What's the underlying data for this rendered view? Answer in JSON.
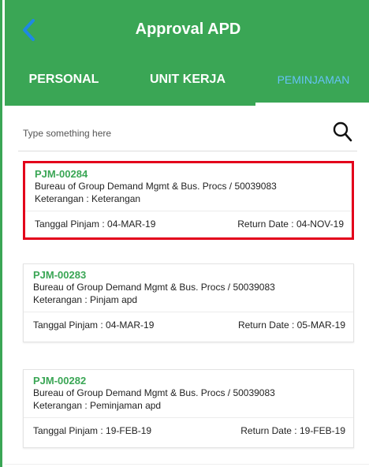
{
  "header": {
    "title": "Approval APD",
    "back_icon": "chevron-left-icon"
  },
  "tabs": [
    {
      "label": "PERSONAL",
      "active": false
    },
    {
      "label": "UNIT KERJA",
      "active": false
    },
    {
      "label": "PEMINJAMAN",
      "active": true
    }
  ],
  "search": {
    "placeholder": "Type something here",
    "value": "",
    "icon": "search-icon"
  },
  "colors": {
    "primary": "#3aa655",
    "active_tab_text": "#66c2f7",
    "highlight_border": "#e3001b",
    "code_text": "#3aa655"
  },
  "items": [
    {
      "code": "PJM-00284",
      "unit": "Bureau of Group Demand Mgmt & Bus. Procs / 50039083",
      "keterangan": "Keterangan : Keterangan",
      "tanggal_pinjam": "Tanggal Pinjam : 04-MAR-19",
      "return_date": "Return Date : 04-NOV-19",
      "selected": true
    },
    {
      "code": "PJM-00283",
      "unit": "Bureau of Group Demand Mgmt & Bus. Procs / 50039083",
      "keterangan": "Keterangan : Pinjam apd",
      "tanggal_pinjam": "Tanggal Pinjam : 04-MAR-19",
      "return_date": "Return Date : 05-MAR-19",
      "selected": false
    },
    {
      "code": "PJM-00282",
      "unit": "Bureau of Group Demand Mgmt & Bus. Procs / 50039083",
      "keterangan": "Keterangan : Peminjaman apd",
      "tanggal_pinjam": "Tanggal Pinjam : 19-FEB-19",
      "return_date": "Return Date : 19-FEB-19",
      "selected": false
    }
  ]
}
